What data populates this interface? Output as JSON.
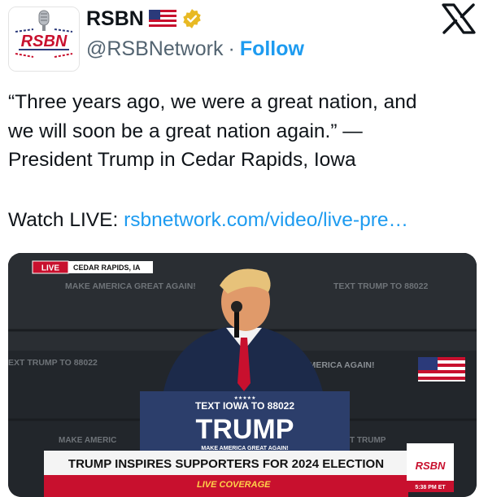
{
  "account": {
    "name": "RSBN",
    "handle": "@RSBNetwork",
    "separator": "·",
    "follow_label": "Follow",
    "avatar_text": "RSBN",
    "flag_icon": "us-flag-icon",
    "verified_icon": "verified-badge-icon"
  },
  "tweet": {
    "lines": [
      "“Three years ago, we were a great nation, and",
      "we will soon be a great nation again.” —",
      "President Trump in Cedar Rapids, Iowa"
    ],
    "watch_prefix": "Watch LIVE: ",
    "link_text": "rsbnetwork.com/video/live-pre…"
  },
  "media": {
    "live_badge": "LIVE",
    "location": "CEDAR RAPIDS, IA",
    "bg_signs": [
      "MAKE AMERICA GREAT AGAIN!",
      "TEXT TRUMP TO 88022",
      "EXT TRUMP TO 88022",
      "AMERICA AGAIN!",
      "MAKE AMERIC",
      "T TRUMP"
    ],
    "podium_top": "TEXT IOWA TO 88022",
    "podium_big": "TRUMP",
    "podium_small": "MAKE AMERICA GREAT AGAIN!",
    "stars": "★★★★★",
    "banner": "TRUMP INSPIRES SUPPORTERS FOR 2024 ELECTION",
    "sub_banner": "LIVE COVERAGE",
    "corner_logo": "RSBN",
    "corner_time": "5:38 PM ET"
  },
  "colors": {
    "accent": "#1d9bf0",
    "text": "#0f1419",
    "secondary": "#536471",
    "live_red": "#c8102e",
    "verified_gold": "#e8b923"
  }
}
